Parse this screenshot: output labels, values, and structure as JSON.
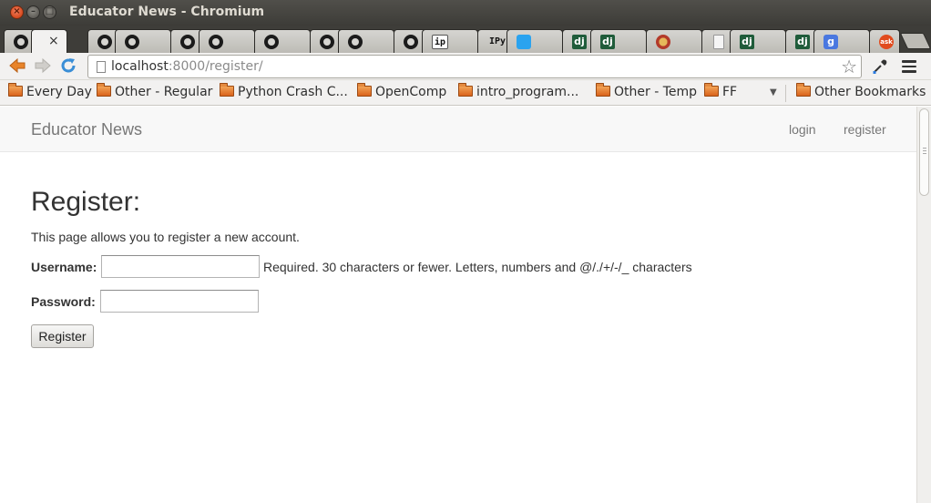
{
  "window": {
    "title": "Educator News - Chromium",
    "controls": {
      "close": "×",
      "minimize": "–",
      "maximize": "□"
    }
  },
  "tabs": [
    {
      "icon": "github-icon"
    },
    {
      "icon": "none",
      "active": true,
      "close": "×"
    },
    {
      "icon": "github-icon"
    },
    {
      "icon": "github-icon"
    },
    {
      "icon": "github-icon"
    },
    {
      "icon": "github-icon"
    },
    {
      "icon": "github-icon"
    },
    {
      "icon": "github-icon"
    },
    {
      "icon": "github-icon"
    },
    {
      "icon": "github-icon"
    },
    {
      "icon": "ip-icon",
      "text": "ip"
    },
    {
      "icon": "ipython-icon",
      "text": "IPy"
    },
    {
      "icon": "twitter-icon"
    },
    {
      "icon": "django-icon",
      "text": "dj"
    },
    {
      "icon": "django-icon",
      "text": "dj"
    },
    {
      "icon": "character-icon"
    },
    {
      "icon": "document-icon"
    },
    {
      "icon": "django-icon",
      "text": "dj"
    },
    {
      "icon": "django-icon",
      "text": "dj"
    },
    {
      "icon": "google-icon",
      "text": "g"
    },
    {
      "icon": "ask-icon",
      "text": "ask"
    }
  ],
  "toolbar": {
    "url_host": "localhost",
    "url_path": ":8000/register/"
  },
  "bookmarks": {
    "items": [
      "Every Day",
      "Other - Regular",
      "Python Crash C...",
      "OpenComp",
      "intro_program...",
      "Other - Temp",
      "FF"
    ],
    "overflow": "▼",
    "other": "Other Bookmarks"
  },
  "page": {
    "brand": "Educator News",
    "nav": {
      "login": "login",
      "register": "register"
    },
    "heading": "Register:",
    "intro": "This page allows you to register a new account.",
    "username_label": "Username:",
    "username_value": "",
    "username_help": "Required. 30 characters or fewer. Letters, numbers and @/./+/-/_ characters",
    "password_label": "Password:",
    "password_value": "",
    "submit_label": "Register"
  }
}
